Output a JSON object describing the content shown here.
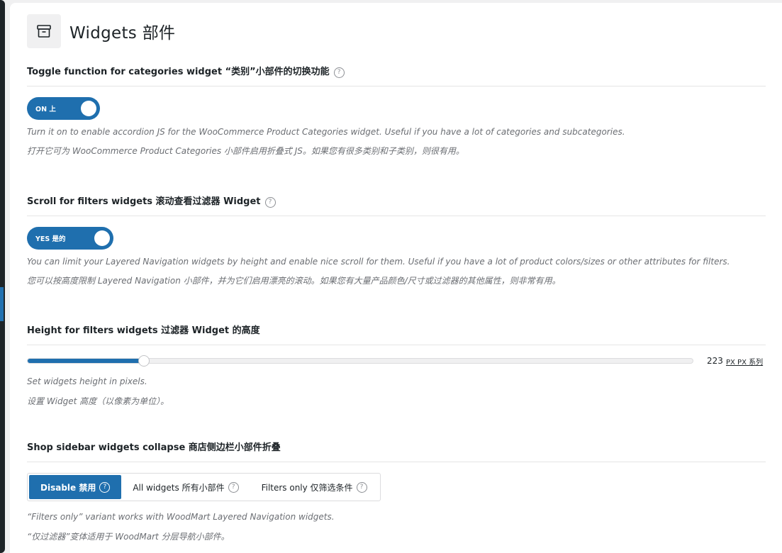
{
  "page": {
    "title": "Widgets  部件",
    "header_icon": "archive-icon"
  },
  "sections": [
    {
      "title": "Toggle function for categories widget  “类别”小部件的切换功能",
      "control": {
        "type": "toggle",
        "label": "ON  上",
        "state": true
      },
      "desc": [
        "Turn it on to enable accordion JS for the WooCommerce Product Categories widget. Useful if you have a lot of categories and subcategories.",
        "打开它可为 WooCommerce Product Categories 小部件启用折叠式 JS。如果您有很多类别和子类别，则很有用。"
      ]
    },
    {
      "title": "Scroll for filters widgets  滚动查看过滤器 Widget",
      "control": {
        "type": "toggle",
        "label": "YES  是的",
        "state": true
      },
      "desc": [
        "You can limit your Layered Navigation widgets by height and enable nice scroll for them. Useful if you have a lot of product colors/sizes or other attributes for filters.",
        "您可以按高度限制 Layered Navigation 小部件，并为它们启用漂亮的滚动。如果您有大量产品颜色/尺寸或过滤器的其他属性，则非常有用。"
      ]
    },
    {
      "title": "Height for filters widgets  过滤器 Widget 的高度",
      "control": {
        "type": "slider",
        "value": "223",
        "unit": "PX  PX 系列",
        "fraction": 0.175
      },
      "desc": [
        "Set widgets height in pixels.",
        "设置 Widget 高度（以像素为单位）。"
      ]
    },
    {
      "title": "Shop sidebar widgets collapse  商店侧边栏小部件折叠",
      "control": {
        "type": "button-group",
        "options": [
          "Disable  禁用",
          "All widgets  所有小部件",
          "Filters only  仅筛选条件"
        ],
        "selected": "Disable  禁用"
      },
      "desc": [
        "“Filters only” variant works with WoodMart Layered Navigation widgets.",
        "“仅过滤器”变体适用于 WoodMart 分层导航小部件。"
      ]
    }
  ],
  "colors": {
    "accent": "#1f6fae",
    "text": "#1d2327",
    "muted": "#6b6e73"
  }
}
